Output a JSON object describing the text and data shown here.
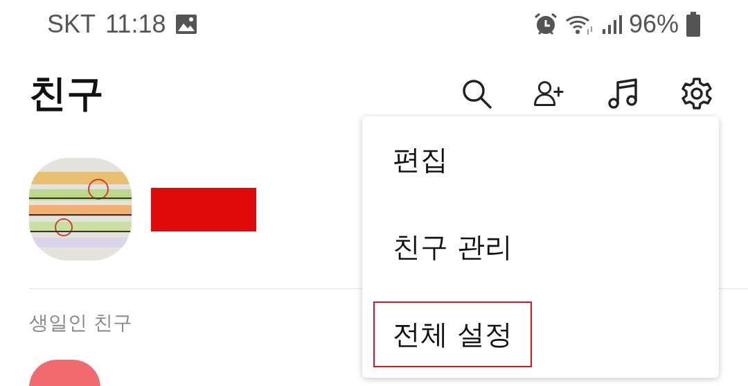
{
  "status_bar": {
    "carrier": "SKT",
    "time": "11:18",
    "battery": "96%"
  },
  "header": {
    "title": "친구"
  },
  "profile": {
    "name_redacted": true
  },
  "sections": [
    {
      "title": "생일인 친구"
    }
  ],
  "menu": {
    "items": [
      {
        "label": "편집",
        "highlighted": false
      },
      {
        "label": "친구 관리",
        "highlighted": false
      },
      {
        "label": "전체 설정",
        "highlighted": true
      }
    ]
  }
}
